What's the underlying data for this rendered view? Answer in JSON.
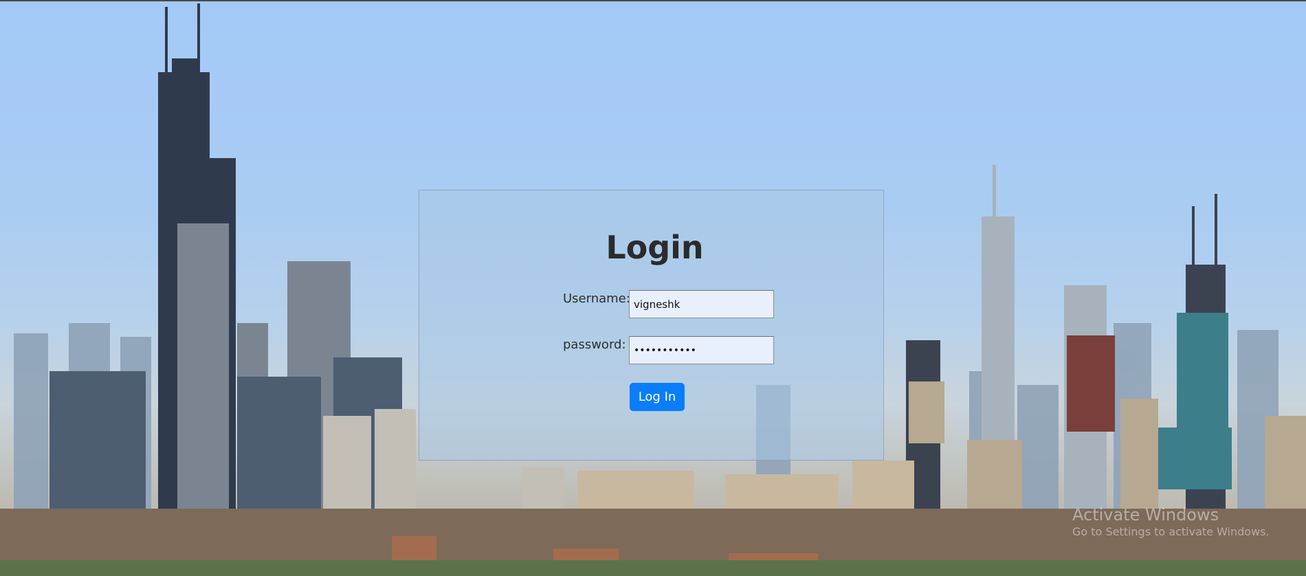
{
  "login": {
    "title": "Login",
    "username_label": "Username:",
    "username_value": "vigneshk",
    "password_label": "password:",
    "password_value": "vigneshk123",
    "submit_label": "Log In"
  },
  "watermark": {
    "line1": "Activate Windows",
    "line2": "Go to Settings to activate Windows."
  },
  "colors": {
    "button": "#0a7dfb",
    "input_bg": "#e8f0fe",
    "sky": "#a3c9f7"
  }
}
